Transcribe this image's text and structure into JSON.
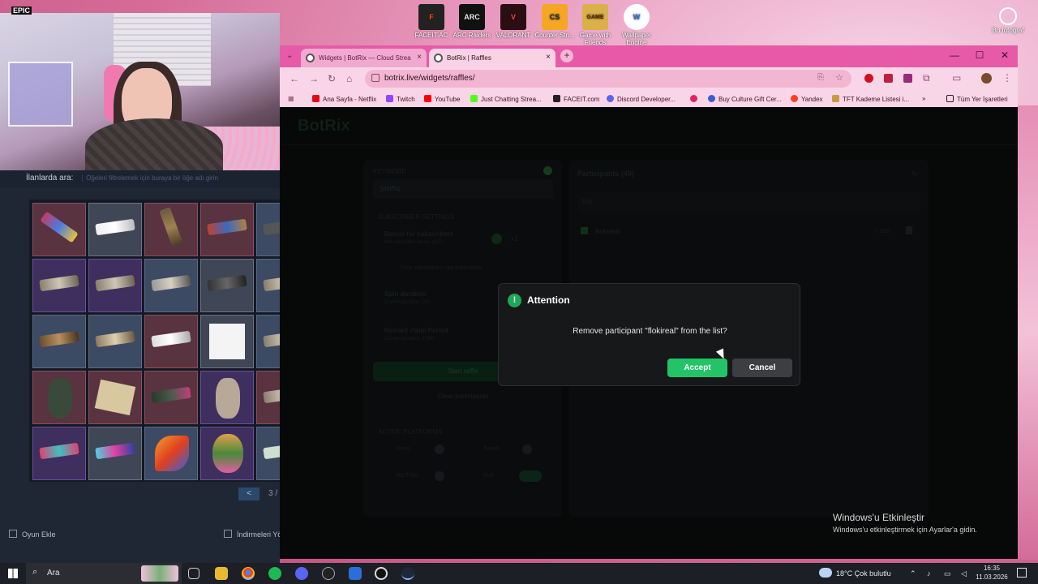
{
  "desktop": {
    "icons": [
      {
        "label": "FACEIT AC",
        "glyph": "F",
        "color": "#ff5500"
      },
      {
        "label": "ARC Raiders",
        "glyph": "ARC",
        "color": "#e8e8e8"
      },
      {
        "label": "VALORANT",
        "glyph": "V",
        "color": "#fa4454"
      },
      {
        "label": "Counter Stri...",
        "glyph": "CS",
        "color": "#f5a623"
      },
      {
        "label": "Game with Friends",
        "glyph": "GAME",
        "color": "#d9b04a"
      },
      {
        "label": "Wallpaper Engine",
        "glyph": "W",
        "color": "#2a6fd8"
      }
    ],
    "right_icon_label": "Bu fotoğraf",
    "epic_label": "EPIC"
  },
  "steam": {
    "search_label": "İlanlarda ara:",
    "search_placeholder": "Öğeleri filtrelemek için buraya bir öğe adı girin",
    "pager_prev": "<",
    "pager_text": "3 /",
    "add_game": "Oyun Ekle",
    "downloads": "İndirmeleri Yön"
  },
  "browser": {
    "tabs": [
      {
        "label": "Widgets | BotRix — Cloud Strea",
        "close": "×"
      },
      {
        "label": "BotRix | Raffles",
        "close": "×"
      }
    ],
    "new_tab": "+",
    "window_controls": {
      "minimize": "—",
      "maximize": "☐",
      "close": "✕"
    },
    "url": "botrix.live/widgets/raffles/",
    "bookmarks": [
      {
        "label": "Ana Sayfa - Netflix",
        "color": "#e50914"
      },
      {
        "label": "Twitch",
        "color": "#9146ff"
      },
      {
        "label": "YouTube",
        "color": "#ff0000"
      },
      {
        "label": "Just Chatting Strea...",
        "color": "#53fc18"
      },
      {
        "label": "FACEIT.com",
        "color": "#222222"
      },
      {
        "label": "Discord Developer...",
        "color": "#5865f2"
      },
      {
        "label": "",
        "color": "#e0245e"
      },
      {
        "label": "Buy Culture Gift Cer...",
        "color": "#3b5bdb"
      },
      {
        "label": "Yandex",
        "color": "#fc3f1d"
      },
      {
        "label": "TFT Kademe Listesi i...",
        "color": "#c89b3c"
      }
    ],
    "bookmarks_more": "»",
    "all_bookmarks": "Tüm Yer İşaretleri"
  },
  "botrix": {
    "brand": "BotRix",
    "keyword_label": "KEYWORD",
    "keyword_value": "!joinfliq",
    "subscriber_settings": "SUBSCRIBER SETTINGS",
    "bonus_label": "Bonus for subscribers",
    "bonus_sub": "Not subscriber bonus (DIT)",
    "bonus_value": "x1",
    "only_subs": "Only subscribers can participate",
    "spin_duration": "Spin duration",
    "spin_sub": "Current duration: 30s",
    "reward_period": "Reward claim Period",
    "reward_sub": "Current duration: 1 Min",
    "start_raffle": "Start raffle",
    "clear_participants": "Clear participants",
    "active_platforms": "ACTIVE PLATFORMS",
    "platforms": [
      "Trovo",
      "Twitch",
      "YouTube",
      "Kick"
    ],
    "participants_title": "Participants (49)",
    "participant_search": "flok",
    "participant_name": "flokireal",
    "participant_points": "☆ 100"
  },
  "dialog": {
    "title": "Attention",
    "icon": "!",
    "message": "Remove participant \"flokireal\" from the list?",
    "accept": "Accept",
    "cancel": "Cancel"
  },
  "windows_activation": {
    "title": "Windows'u Etkinleştir",
    "subtitle": "Windows'u etkinleştirmek için Ayarlar'a gidin."
  },
  "taskbar": {
    "search": "Ara",
    "weather": "18°C  Çok bulutlu",
    "time": "16:35",
    "date": "11.03.2026"
  }
}
